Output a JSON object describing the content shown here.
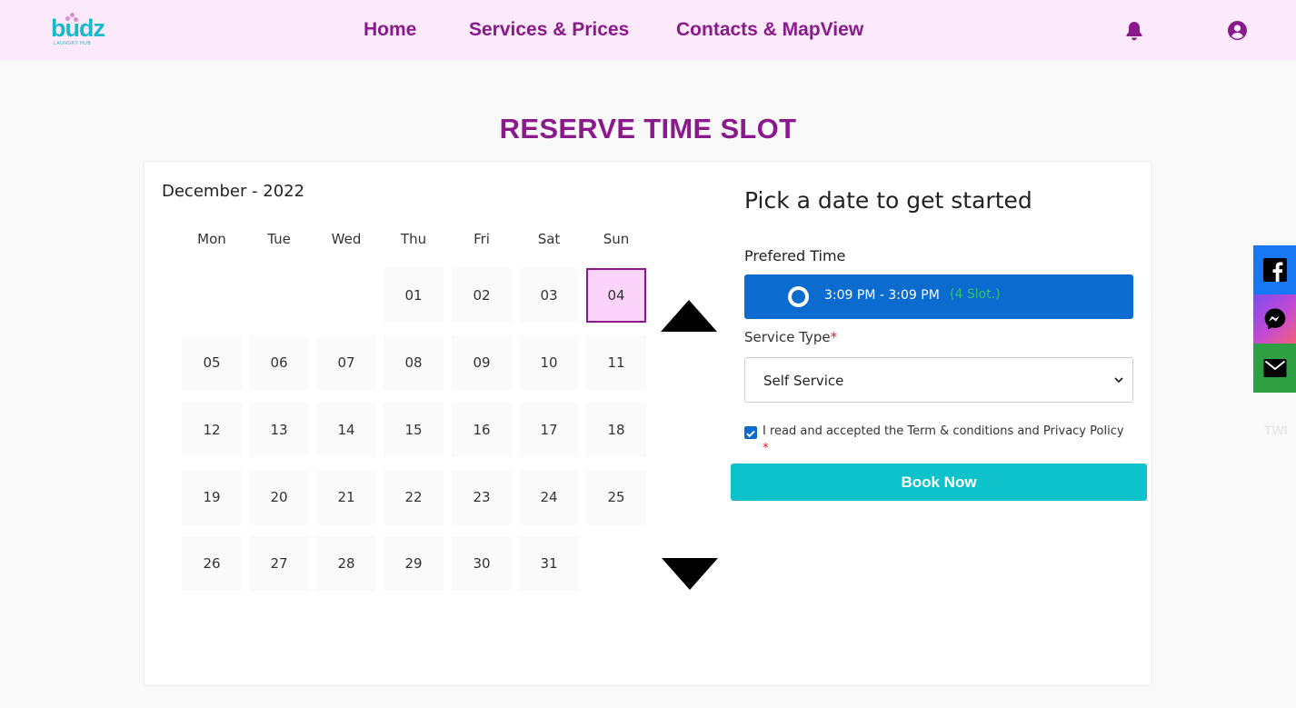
{
  "header": {
    "logo_text": "budz",
    "logo_sub": "LAUNDRY HUB",
    "nav": {
      "home": "Home",
      "services": "Services & Prices",
      "contacts": "Contacts & MapView"
    },
    "icons": [
      "bell-icon",
      "user-circle-icon"
    ]
  },
  "page": {
    "title": "RESERVE TIME SLOT"
  },
  "calendar": {
    "month_label": "December - 2022",
    "weekdays": [
      "Mon",
      "Tue",
      "Wed",
      "Thu",
      "Fri",
      "Sat",
      "Sun"
    ],
    "days": [
      "01",
      "02",
      "03",
      "04",
      "05",
      "06",
      "07",
      "08",
      "09",
      "10",
      "11",
      "12",
      "13",
      "14",
      "15",
      "16",
      "17",
      "18",
      "19",
      "20",
      "21",
      "22",
      "23",
      "24",
      "25",
      "26",
      "27",
      "28",
      "29",
      "30",
      "31"
    ],
    "selected_day": "04",
    "first_weekday_index": 3
  },
  "booking": {
    "heading": "Pick a date to get started",
    "preferred_time_label": "Prefered Time",
    "time_range": "3:09 PM - 3:09 PM",
    "slots": "(4 Slot.)",
    "service_type_label": "Service Type",
    "required_mark": "*",
    "service_selected": "Self Service",
    "terms_text": "I read and accepted the Term & conditions and Privacy Policy",
    "terms_checked": true,
    "book_button": "Book Now"
  },
  "social": {
    "items": [
      "facebook-icon",
      "messenger-icon",
      "email-icon"
    ],
    "partial_label": "TWI"
  },
  "colors": {
    "brand_purple": "#8a1a8c",
    "nav_bg": "#fce9fb",
    "slot_blue": "#0b6bcf",
    "slot_green": "#2ec46a",
    "book_teal": "#0ec2cb",
    "selected_bg": "#fcd3fb"
  }
}
